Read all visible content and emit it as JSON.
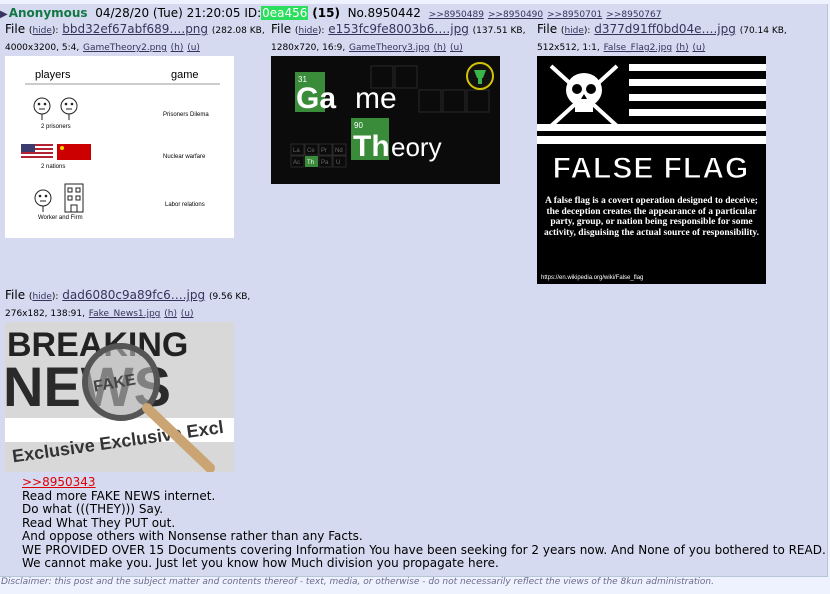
{
  "post": {
    "name": "Anonymous",
    "date": "04/28/20 (Tue) 21:20:05",
    "id_label": "ID:",
    "id_value": "0ea456",
    "post_count": "(15)",
    "number": "No.8950442",
    "backlinks": [
      ">>8950489",
      ">>8950490",
      ">>8950701",
      ">>8950767"
    ]
  },
  "files": [
    {
      "prefix": "File",
      "hide": "hide",
      "name": "bbd32ef67abf689….png",
      "meta1": "(282.08 KB,",
      "meta2": "4000x3200, 5:4,",
      "orig": "GameTheory2.png",
      "h": "(h)",
      "u": "(u)",
      "image": {
        "col_players": "players",
        "col_game": "game",
        "rows": [
          {
            "caption": "2 prisoners",
            "label": "Prisoners Dilema"
          },
          {
            "caption": "2 nations",
            "label": "Nuclear warfare"
          },
          {
            "caption": "Worker and Firm",
            "label": "Labor relations"
          }
        ]
      }
    },
    {
      "prefix": "File",
      "hide": "hide",
      "name": "e153fc9fe8003b6….jpg",
      "meta1": "(137.51 KB,",
      "meta2": "1280x720, 16:9,",
      "orig": "GameTheory3.jpg",
      "h": "(h)",
      "u": "(u)",
      "image": {
        "num1": "31",
        "word1_a": "Ga",
        "word1_b": "me",
        "num2": "90",
        "word2_a": "Th",
        "word2_b": "eory",
        "cells": [
          "La",
          "Ce",
          "Pr",
          "Nd",
          "Ac",
          "Th",
          "Pa",
          "U"
        ]
      }
    },
    {
      "prefix": "File",
      "hide": "hide",
      "name": "d377d91ff0bd04e….jpg",
      "meta1": "(70.14 KB,",
      "meta2": "512x512, 1:1,",
      "orig": "False_Flag2.jpg",
      "h": "(h)",
      "u": "(u)",
      "image": {
        "title": "FALSE FLAG",
        "text": "A false flag is a covert operation designed to deceive; the deception creates the appearance of a particular party, group, or nation being responsible for some activity, disguising the actual source of responsibility.",
        "url": "https://en.wikipedia.org/wiki/False_flag"
      }
    },
    {
      "prefix": "File",
      "hide": "hide",
      "name": "dad6080c9a89fc6….jpg",
      "meta1": "(9.56 KB,",
      "meta2": "276x182, 138:91,",
      "orig": "Fake_News1.jpg",
      "h": "(h)",
      "u": "(u)",
      "image": {
        "line1": "BREAKING",
        "line2": "NEWS",
        "fake": "FAKE",
        "line3": "Exclusive Exclusive Excl"
      }
    }
  ],
  "body": {
    "quote": ">>8950343",
    "lines": [
      "Read more FAKE NEWS internet.",
      "Do what (((THEY))) Say.",
      "Read What They PUT out.",
      "And oppose others with Nonsense rather than any Facts.",
      "WE PROVIDED OVER 15 Documents covering Information You have been seeking for 2 years now. And None of you bothered to READ.",
      "We cannot make you. Just let you know how Much division you propagate here."
    ]
  },
  "disclaimer": "Disclaimer: this post and the subject matter and contents thereof - text, media, or otherwise - do not necessarily reflect the views of the 8kun administration."
}
